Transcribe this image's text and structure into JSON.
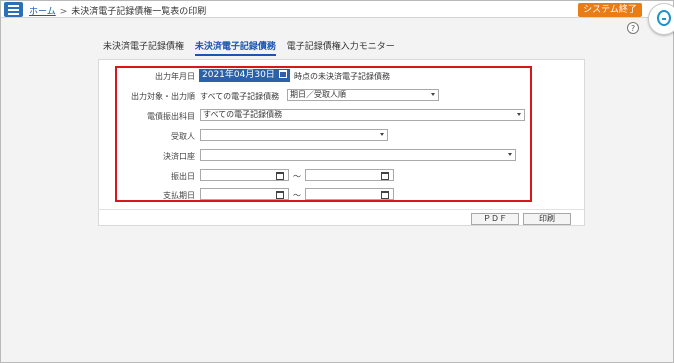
{
  "header": {
    "home_link": "ホーム",
    "separator": ">",
    "page_title": "未決済電子記録債権一覧表の印刷",
    "exit_button": "システム終了",
    "help_icon": "?"
  },
  "tabs": [
    {
      "label": "未決済電子記録債権",
      "active": false
    },
    {
      "label": "未決済電子記録債務",
      "active": true
    },
    {
      "label": "電子記録債権入力モニター",
      "active": false
    }
  ],
  "form": {
    "output_date": {
      "label": "出力年月日",
      "value": "2021年04月30日",
      "suffix": "時点の未決済電子記録債務"
    },
    "output_target": {
      "label": "出力対象・出力順",
      "value": "すべての電子記録債務",
      "order": "期日／受取人順"
    },
    "issuer": {
      "label": "電債振出科目",
      "value": "すべての電子記録債務"
    },
    "payee": {
      "label": "受取人",
      "value": ""
    },
    "account": {
      "label": "決済口座",
      "value": ""
    },
    "issue_date": {
      "label": "振出日",
      "from": "",
      "to": "",
      "range_sep": "～"
    },
    "due_date": {
      "label": "支払期日",
      "from": "",
      "to": "",
      "range_sep": "～"
    }
  },
  "actions": {
    "pdf": "ＰＤＦ",
    "print": "印刷"
  },
  "colors": {
    "accent": "#2b61a8",
    "exit": "#e87d18",
    "highlight": "#d71718"
  }
}
